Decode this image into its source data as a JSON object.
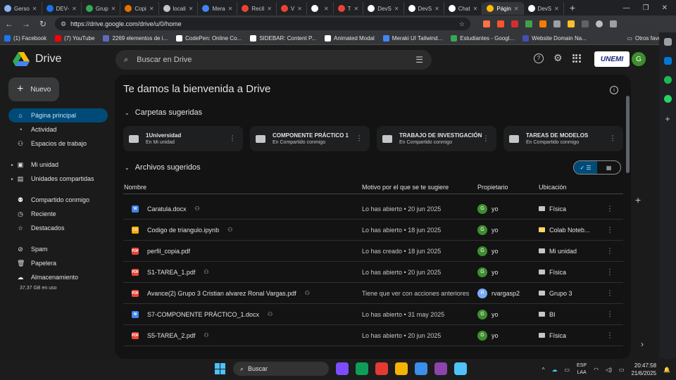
{
  "browser": {
    "tabs": [
      {
        "label": "Gerso",
        "color": "#8ab4f8"
      },
      {
        "label": "DEV-",
        "color": "#1a73e8"
      },
      {
        "label": "Grup",
        "color": "#34a853"
      },
      {
        "label": "Copi",
        "color": "#e37400"
      },
      {
        "label": "locali",
        "color": "#c4c7c5"
      },
      {
        "label": "Mera",
        "color": "#4285f4"
      },
      {
        "label": "Recil",
        "color": "#ea4335"
      },
      {
        "label": "V",
        "color": "#ea4335"
      },
      {
        "label": "",
        "color": "#ffffff"
      },
      {
        "label": "T",
        "color": "#ea4335"
      },
      {
        "label": "DevS",
        "color": "#ffffff"
      },
      {
        "label": "DevS",
        "color": "#ffffff"
      },
      {
        "label": "Chat",
        "color": "#ffffff"
      },
      {
        "label": "Págin",
        "color": "#fbbc04",
        "active": true
      },
      {
        "label": "DevS",
        "color": "#ffffff"
      }
    ],
    "url": "https://drive.google.com/drive/u/0/home",
    "bookmarks": [
      {
        "label": "(1) Facebook",
        "color": "#1877f2"
      },
      {
        "label": "(7) YouTube",
        "color": "#ff0000"
      },
      {
        "label": "2269 elementos de i...",
        "color": "#5c6bc0"
      },
      {
        "label": "CodePen: Online Co...",
        "color": "#ffffff"
      },
      {
        "label": "SIDEBAR: Content P...",
        "color": "#ffffff"
      },
      {
        "label": "Animated Modal",
        "color": "#ffffff"
      },
      {
        "label": "Meraki UI Tailwind...",
        "color": "#4285f4"
      },
      {
        "label": "Estudiantes - Googl...",
        "color": "#34a853"
      },
      {
        "label": "Website Domain Na...",
        "color": "#3f51b5"
      }
    ],
    "other_bookmarks": "Otros favoritos"
  },
  "drive": {
    "app_name": "Drive",
    "search_placeholder": "Buscar en Drive",
    "org_logo": "UNEMI",
    "avatar_letter": "G",
    "new_button": "Nuevo",
    "nav": [
      {
        "label": "Página principal",
        "icon": "home-icon",
        "glyph": "⌂",
        "active": true
      },
      {
        "label": "Actividad",
        "icon": "activity-icon",
        "glyph": "◔"
      },
      {
        "label": "Espacios de trabajo",
        "icon": "workspaces-icon",
        "glyph": "⚇"
      },
      {
        "gap": true
      },
      {
        "label": "Mi unidad",
        "icon": "my-drive-icon",
        "glyph": "▣",
        "caret": true
      },
      {
        "label": "Unidades compartidas",
        "icon": "shared-drives-icon",
        "glyph": "▤",
        "caret": true
      },
      {
        "gap": true
      },
      {
        "label": "Compartido conmigo",
        "icon": "shared-with-me-icon",
        "glyph": "⚉"
      },
      {
        "label": "Reciente",
        "icon": "recent-icon",
        "glyph": "◷"
      },
      {
        "label": "Destacados",
        "icon": "starred-icon",
        "glyph": "☆"
      },
      {
        "gap": true
      },
      {
        "label": "Spam",
        "icon": "spam-icon",
        "glyph": "⊘"
      },
      {
        "label": "Papelera",
        "icon": "trash-icon",
        "glyph": "🗑"
      },
      {
        "label": "Almacenamiento",
        "icon": "storage-icon",
        "glyph": "☁"
      }
    ],
    "storage_text": "37,37 GB en uso",
    "welcome": "Te damos la bienvenida a Drive",
    "suggested_folders_title": "Carpetas sugeridas",
    "folders": [
      {
        "name": "1Universidad",
        "sub": "En Mi unidad"
      },
      {
        "name": "COMPONENTE PRÁCTICO 1",
        "sub": "En Compartido conmigo"
      },
      {
        "name": "TRABAJO DE INVESTIGACIÓN",
        "sub": "En Compartido conmigo"
      },
      {
        "name": "TAREAS DE MODELOS",
        "sub": "En Compartido conmigo"
      }
    ],
    "suggested_files_title": "Archivos sugeridos",
    "columns": {
      "name": "Nombre",
      "reason": "Motivo por el que se te sugiere",
      "owner": "Propietario",
      "location": "Ubicación"
    },
    "files": [
      {
        "name": "Caratula.docx",
        "type": "W",
        "color": "#4285f4",
        "shared": true,
        "reason": "Lo has abierto • 20 jun 2025",
        "owner": "yo",
        "owner_color": "#3e8e2f",
        "owner_letter": "G",
        "location": "Física",
        "loc_color": "#c4c7c5"
      },
      {
        "name": "Codigo de triangulo.ipynb",
        "type": "CO",
        "color": "#f9ab00",
        "shared": true,
        "reason": "Lo has abierto • 18 jun 2025",
        "owner": "yo",
        "owner_color": "#3e8e2f",
        "owner_letter": "G",
        "location": "Colab Noteb...",
        "loc_color": "#fdd663"
      },
      {
        "name": "perfil_copia.pdf",
        "type": "PDF",
        "color": "#ea4335",
        "shared": false,
        "reason": "Lo has creado • 18 jun 2025",
        "owner": "yo",
        "owner_color": "#3e8e2f",
        "owner_letter": "G",
        "location": "Mi unidad",
        "loc_color": "#c4c7c5"
      },
      {
        "name": "S1-TAREA_1.pdf",
        "type": "PDF",
        "color": "#ea4335",
        "shared": true,
        "reason": "Lo has abierto • 20 jun 2025",
        "owner": "yo",
        "owner_color": "#3e8e2f",
        "owner_letter": "G",
        "location": "Física",
        "loc_color": "#c4c7c5"
      },
      {
        "name": "Avance(2) Grupo 3 Cristian alvarez Ronal Vargas.pdf",
        "type": "PDF",
        "color": "#ea4335",
        "shared": true,
        "reason": "Tiene que ver con acciones anteriores",
        "owner": "rvargasp2",
        "owner_color": "#7baaf7",
        "owner_letter": "R",
        "location": "Grupo 3",
        "loc_color": "#c4c7c5"
      },
      {
        "name": "S7-COMPONENTE PRÁCTICO_1.docx",
        "type": "W",
        "color": "#4285f4",
        "shared": true,
        "reason": "Lo has abierto • 31 may 2025",
        "owner": "yo",
        "owner_color": "#3e8e2f",
        "owner_letter": "G",
        "location": "BI",
        "loc_color": "#c4c7c5"
      },
      {
        "name": "S5-TAREA_2.pdf",
        "type": "PDF",
        "color": "#ea4335",
        "shared": true,
        "reason": "Lo has abierto • 20 jun 2025",
        "owner": "yo",
        "owner_color": "#3e8e2f",
        "owner_letter": "G",
        "location": "Física",
        "loc_color": "#c4c7c5"
      }
    ]
  },
  "taskbar": {
    "search": "Buscar",
    "lang_1": "ESP",
    "lang_2": "LAA",
    "time": "20:47:58",
    "date": "21/6/2025",
    "apps": [
      "#7c4dff",
      "#0f9d58",
      "#e53935",
      "#f4b400",
      "#3b8eea",
      "#8e44ad",
      "#4fc3f7"
    ]
  }
}
